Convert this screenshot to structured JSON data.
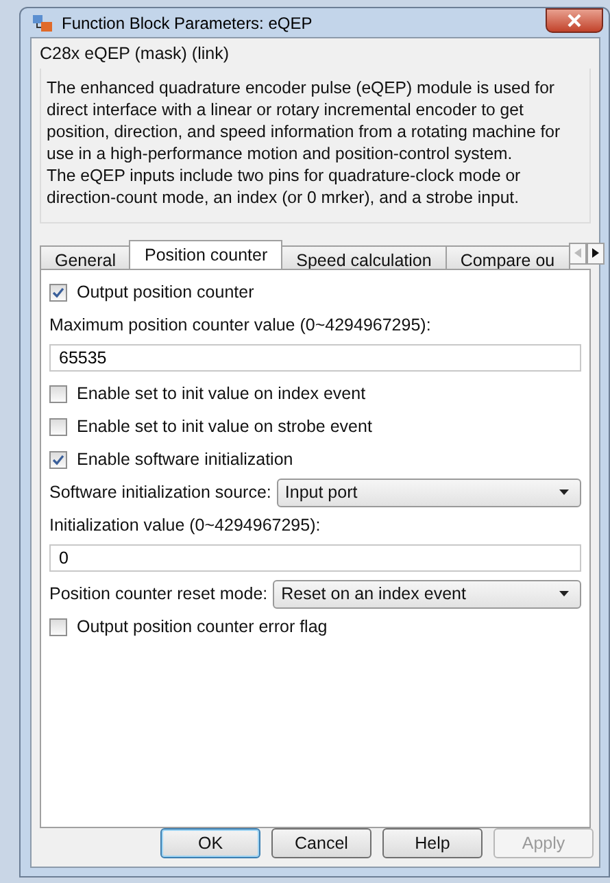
{
  "window": {
    "title": "Function Block Parameters: eQEP"
  },
  "group": {
    "title": "C28x eQEP (mask) (link)",
    "description": "The enhanced quadrature encoder pulse (eQEP) module is used for direct interface with a linear or rotary incremental encoder to get position, direction, and speed information from a rotating machine for use in a high-performance motion and position-control system.\nThe eQEP inputs include two pins for quadrature-clock mode or direction-count mode, an index (or 0 mrker), and a strobe input."
  },
  "tabs": [
    {
      "label": "General",
      "selected": false
    },
    {
      "label": "Position counter",
      "selected": true
    },
    {
      "label": "Speed calculation",
      "selected": false
    },
    {
      "label": "Compare ou",
      "selected": false
    }
  ],
  "params": [
    {
      "kind": "checkbox",
      "label": "Output position counter",
      "checked": true
    },
    {
      "kind": "label",
      "text": "Maximum position counter value (0~4294967295):"
    },
    {
      "kind": "input",
      "value": "65535"
    },
    {
      "kind": "checkbox",
      "label": "Enable set to init value on index event",
      "checked": false
    },
    {
      "kind": "checkbox",
      "label": "Enable set to init value on strobe event",
      "checked": false
    },
    {
      "kind": "checkbox",
      "label": "Enable software initialization",
      "checked": true
    },
    {
      "kind": "select",
      "label": "Software initialization source:",
      "value": "Input port"
    },
    {
      "kind": "label",
      "text": "Initialization value (0~4294967295):"
    },
    {
      "kind": "input",
      "value": "0"
    },
    {
      "kind": "select",
      "label": "Position counter reset mode:",
      "value": "Reset on an index event"
    },
    {
      "kind": "checkbox",
      "label": "Output position counter error flag",
      "checked": false
    }
  ],
  "buttons": [
    {
      "label": "OK",
      "default": true,
      "disabled": false
    },
    {
      "label": "Cancel",
      "default": false,
      "disabled": false
    },
    {
      "label": "Help",
      "default": false,
      "disabled": false
    },
    {
      "label": "Apply",
      "default": false,
      "disabled": true
    }
  ]
}
